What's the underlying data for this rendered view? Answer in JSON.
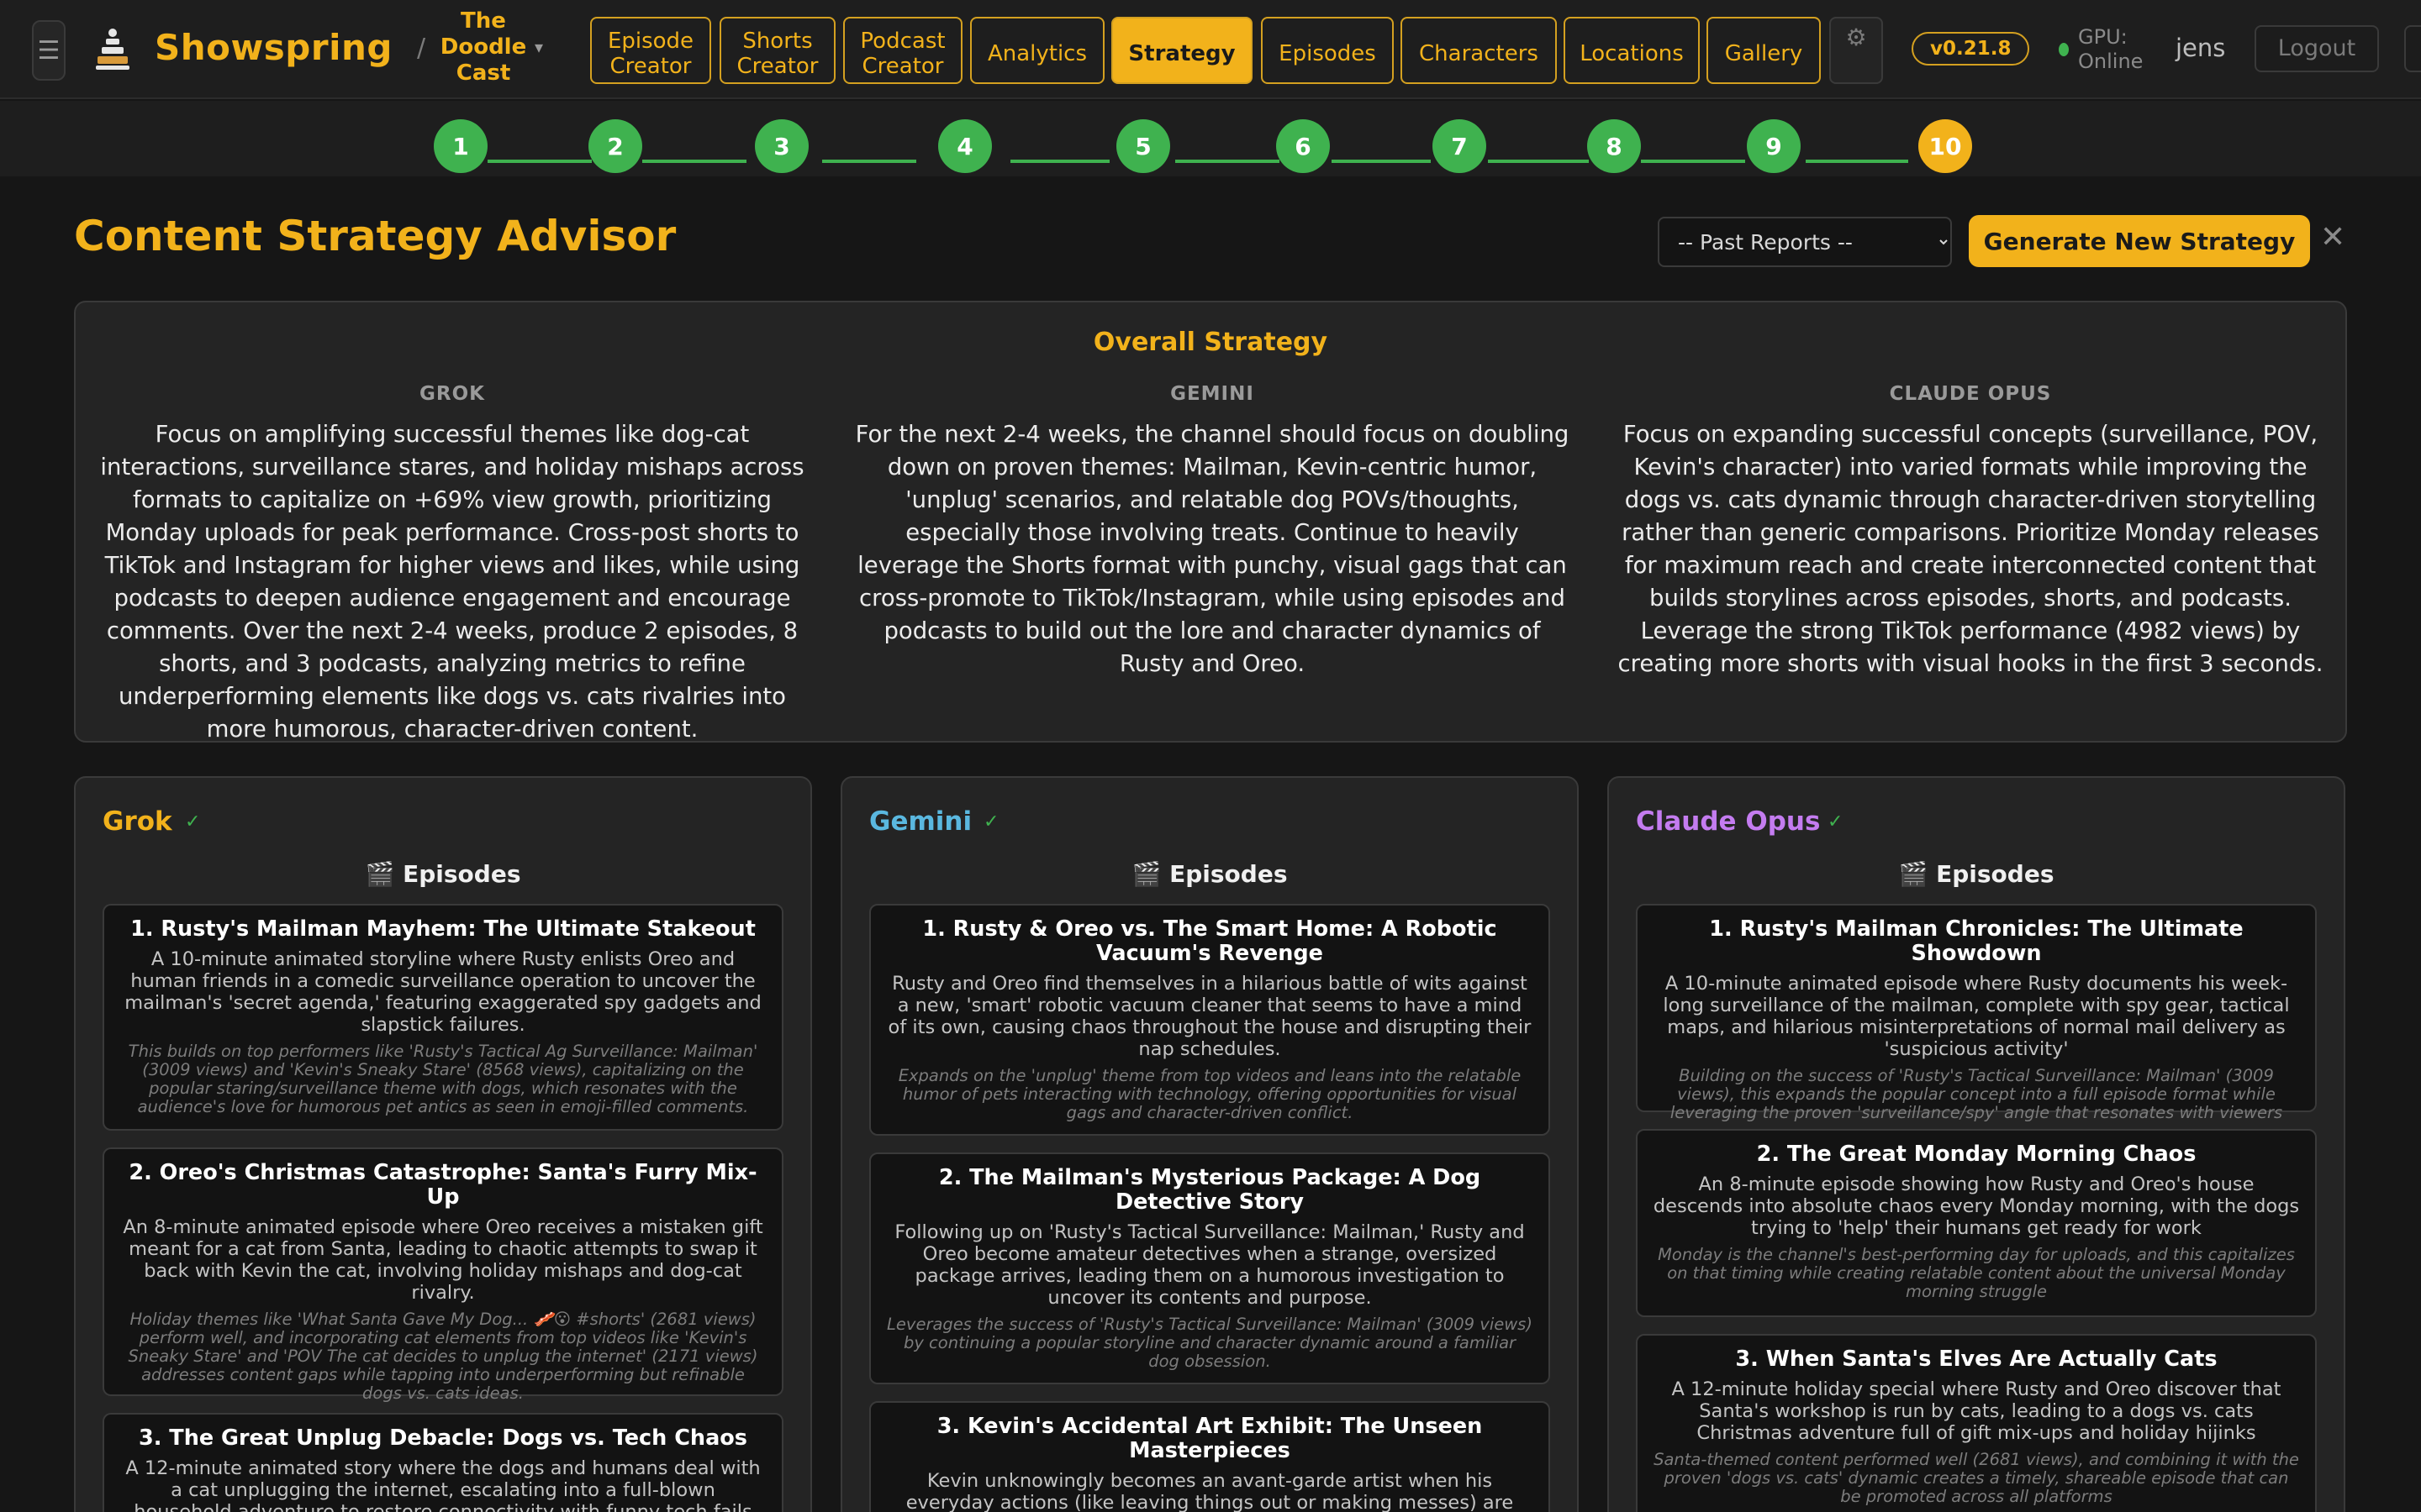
{
  "app": {
    "brand": "Showspring",
    "show_name": "The Doodle Cast",
    "version": "v0.21.8",
    "gpu_status": "GPU: Online",
    "username": "jens",
    "logout_label": "Logout",
    "brand_color": "#f2b21b"
  },
  "icons": {
    "menu": "hamburger-icon",
    "logo": "clapper-stack-icon",
    "settings": "gear-icon",
    "close": "close-icon",
    "episodes": "clapperboard-icon",
    "check": "check-icon"
  },
  "nav": [
    {
      "label": "Episode Creator"
    },
    {
      "label": "Shorts Creator"
    },
    {
      "label": "Podcast Creator"
    },
    {
      "label": "Analytics"
    },
    {
      "label": "Strategy",
      "active": true
    },
    {
      "label": "Episodes"
    },
    {
      "label": "Characters"
    },
    {
      "label": "Locations"
    },
    {
      "label": "Gallery"
    }
  ],
  "stepper": {
    "steps": [
      "1",
      "2",
      "3",
      "4",
      "5",
      "6",
      "7",
      "8",
      "9",
      "10"
    ],
    "current": "10"
  },
  "page": {
    "title": "Content Strategy Advisor",
    "past_reports_placeholder": "-- Past Reports --",
    "generate_label": "Generate New Strategy",
    "close_glyph": "✕"
  },
  "overall": {
    "title": "Overall Strategy",
    "columns": [
      {
        "label": "GROK",
        "text": "Focus on amplifying successful themes like dog-cat interactions, surveillance stares, and holiday mishaps across formats to capitalize on +69% view growth, prioritizing Monday uploads for peak performance. Cross-post shorts to TikTok and Instagram for higher views and likes, while using podcasts to deepen audience engagement and encourage comments. Over the next 2-4 weeks, produce 2 episodes, 8 shorts, and 3 podcasts, analyzing metrics to refine underperforming elements like dogs vs. cats rivalries into more humorous, character-driven content."
      },
      {
        "label": "GEMINI",
        "text": "For the next 2-4 weeks, the channel should focus on doubling down on proven themes: Mailman, Kevin-centric humor, 'unplug' scenarios, and relatable dog POVs/thoughts, especially those involving treats. Continue to heavily leverage the Shorts format with punchy, visual gags that can cross-promote to TikTok/Instagram, while using episodes and podcasts to build out the lore and character dynamics of Rusty and Oreo."
      },
      {
        "label": "CLAUDE OPUS",
        "text": "Focus on expanding successful concepts (surveillance, POV, Kevin's character) into varied formats while improving the dogs vs. cats dynamic through character-driven storytelling rather than generic comparisons. Prioritize Monday releases for maximum reach and create interconnected content that builds storylines across episodes, shorts, and podcasts. Leverage the strong TikTok performance (4982 views) by creating more shorts with visual hooks in the first 3 seconds."
      }
    ]
  },
  "models": [
    {
      "name": "Grok",
      "color": "#f2b21b",
      "check": "✓",
      "section": "Episodes",
      "episodes": [
        {
          "title": "1. Rusty's Mailman Mayhem: The Ultimate Stakeout",
          "desc": "A 10-minute animated storyline where Rusty enlists Oreo and human friends in a comedic surveillance operation to uncover the mailman's 'secret agenda,' featuring exaggerated spy gadgets and slapstick failures.",
          "reason": "This builds on top performers like 'Rusty's Tactical Ag Surveillance: Mailman' (3009 views) and 'Kevin's Sneaky Stare' (8568 views), capitalizing on the popular staring/surveillance theme with dogs, which resonates with the audience's love for humorous pet antics as seen in emoji-filled comments."
        },
        {
          "title": "2. Oreo's Christmas Catastrophe: Santa's Furry Mix-Up",
          "desc": "An 8-minute animated episode where Oreo receives a mistaken gift meant for a cat from Santa, leading to chaotic attempts to swap it back with Kevin the cat, involving holiday mishaps and dog-cat rivalry.",
          "reason": "Holiday themes like 'What Santa Gave My Dog... 🥓😮 #shorts' (2681 views) perform well, and incorporating cat elements from top videos like 'Kevin's Sneaky Stare' and 'POV The cat decides to unplug the internet' (2171 views) addresses content gaps while tapping into underperforming but refinable dogs vs. cats ideas."
        },
        {
          "title": "3. The Great Unplug Debacle: Dogs vs. Tech Chaos",
          "desc": "A 12-minute animated story where the dogs and humans deal with a cat unplugging the internet, escalating into a full-blown household adventure to restore connectivity with funny tech fails and",
          "reason": ""
        }
      ]
    },
    {
      "name": "Gemini",
      "color": "#5ab8e0",
      "check": "✓",
      "section": "Episodes",
      "episodes": [
        {
          "title": "1. Rusty & Oreo vs. The Smart Home: A Robotic Vacuum's Revenge",
          "desc": "Rusty and Oreo find themselves in a hilarious battle of wits against a new, 'smart' robotic vacuum cleaner that seems to have a mind of its own, causing chaos throughout the house and disrupting their nap schedules.",
          "reason": "Expands on the 'unplug' theme from top videos and leans into the relatable humor of pets interacting with technology, offering opportunities for visual gags and character-driven conflict."
        },
        {
          "title": "2. The Mailman's Mysterious Package: A Dog Detective Story",
          "desc": "Following up on 'Rusty's Tactical Surveillance: Mailman,' Rusty and Oreo become amateur detectives when a strange, oversized package arrives, leading them on a humorous investigation to uncover its contents and purpose.",
          "reason": "Leverages the success of 'Rusty's Tactical Surveillance: Mailman' (3009 views) by continuing a popular storyline and character dynamic around a familiar dog obsession."
        },
        {
          "title": "3. Kevin's Accidental Art Exhibit: The Unseen Masterpieces",
          "desc": "Kevin unknowingly becomes an avant-garde artist when his everyday actions (like leaving things out or making messes) are interpreted as",
          "reason": ""
        }
      ]
    },
    {
      "name": "Claude Opus",
      "color": "#c47cf0",
      "check": "✓",
      "section": "Episodes",
      "episodes": [
        {
          "title": "1. Rusty's Mailman Chronicles: The Ultimate Showdown",
          "desc": "A 10-minute animated episode where Rusty documents his week-long surveillance of the mailman, complete with spy gear, tactical maps, and hilarious misinterpretations of normal mail delivery as 'suspicious activity'",
          "reason": "Building on the success of 'Rusty's Tactical Surveillance: Mailman' (3009 views), this expands the popular concept into a full episode format while leveraging the proven 'surveillance/spy' angle that resonates with viewers"
        },
        {
          "title": "2. The Great Monday Morning Chaos",
          "desc": "An 8-minute episode showing how Rusty and Oreo's house descends into absolute chaos every Monday morning, with the dogs trying to 'help' their humans get ready for work",
          "reason": "Monday is the channel's best-performing day for uploads, and this capitalizes on that timing while creating relatable content about the universal Monday morning struggle"
        },
        {
          "title": "3. When Santa's Elves Are Actually Cats",
          "desc": "A 12-minute holiday special where Rusty and Oreo discover that Santa's workshop is run by cats, leading to a dogs vs. cats Christmas adventure full of gift mix-ups and holiday hijinks",
          "reason": "Santa-themed content performed well (2681 views), and combining it with the proven 'dogs vs. cats' dynamic creates a timely, shareable episode that can be promoted across all platforms"
        }
      ]
    }
  ]
}
